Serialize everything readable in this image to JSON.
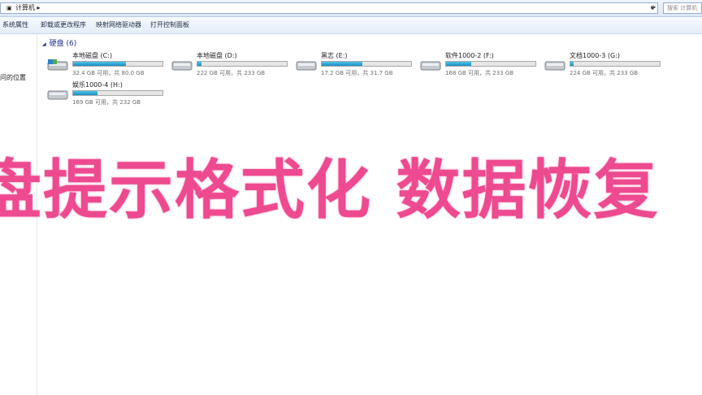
{
  "address": {
    "crumb": "计算机 ▸",
    "search_placeholder": "搜索 计算机"
  },
  "toolbar": {
    "buttons": [
      "系统属性",
      "卸载或更改程序",
      "映射网络驱动器",
      "打开控制面板"
    ]
  },
  "nav": {
    "item": "问的位置"
  },
  "section": {
    "title": "硬盘 (6)"
  },
  "drives": [
    {
      "name": "本地磁盘 (C:)",
      "info": "32.4 GB 可用，共 80.0 GB",
      "used": 0.595
    },
    {
      "name": "本地磁盘 (D:)",
      "info": "222 GB 可用，共 233 GB",
      "used": 0.047
    },
    {
      "name": "黑志 (E:)",
      "info": "17.2 GB 可用，共 31.7 GB",
      "used": 0.457
    },
    {
      "name": "软件1000-2 (F:)",
      "info": "168 GB 可用，共 233 GB",
      "used": 0.279
    },
    {
      "name": "文档1000-3 (G:)",
      "info": "224 GB 可用，共 233 GB",
      "used": 0.039
    },
    {
      "name": "娱乐1000-4 (H:)",
      "info": "169 GB 可用，共 232 GB",
      "used": 0.272
    }
  ],
  "overlay": {
    "caption": "盘提示格式化 数据恢复"
  },
  "colors": {
    "accent": "#ee4a8f",
    "bar_fill": "#1c8cc3",
    "header_text": "#1e3287"
  }
}
